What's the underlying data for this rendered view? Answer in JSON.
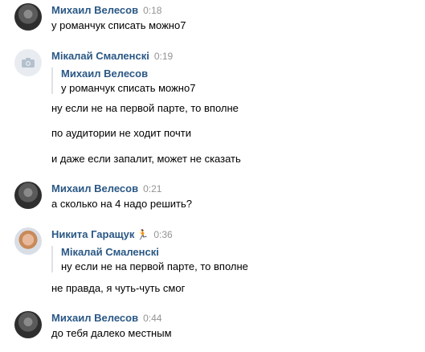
{
  "messages": [
    {
      "author": "Михаил Велесов",
      "time": "0:18",
      "lines": [
        "у романчук списать можно7"
      ]
    },
    {
      "author": "Мікалай Смаленскі",
      "time": "0:19",
      "quote": {
        "author": "Михаил Велесов",
        "text": "у романчук списать можно7"
      },
      "lines": [
        "ну если не на первой парте, то вполне",
        "по аудитории не ходит почти",
        "и даже если запалит, может не сказать"
      ]
    },
    {
      "author": "Михаил Велесов",
      "time": "0:21",
      "lines": [
        "а сколько на 4 надо решить?"
      ]
    },
    {
      "author": "Никита Гаращук",
      "time": "0:36",
      "status_icon": "running-person-icon",
      "quote": {
        "author": "Мікалай Смаленскі",
        "text": "ну если не на первой парте, то вполне"
      },
      "lines": [
        "не правда, я чуть-чуть смог"
      ]
    },
    {
      "author": "Михаил Велесов",
      "time": "0:44",
      "lines": [
        "до тебя далеко местным"
      ]
    }
  ]
}
